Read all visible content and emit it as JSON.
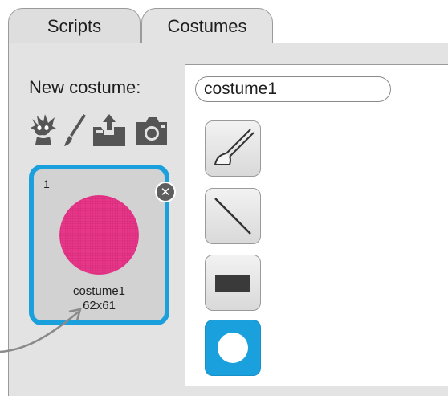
{
  "tabs": {
    "scripts": "Scripts",
    "costumes": "Costumes"
  },
  "new_costume": {
    "label": "New costume:",
    "sources": [
      "sprite-library-icon",
      "paint-brush-icon",
      "upload-icon",
      "camera-icon"
    ]
  },
  "costume": {
    "index": "1",
    "name": "costume1",
    "size": "62x61",
    "color": "#e8388a",
    "selected_border": "#1aa0dc"
  },
  "editor": {
    "name_value": "costume1",
    "tools": [
      "brush-tool",
      "line-tool",
      "rectangle-tool",
      "ellipse-tool"
    ],
    "selected_tool": "ellipse-tool"
  }
}
